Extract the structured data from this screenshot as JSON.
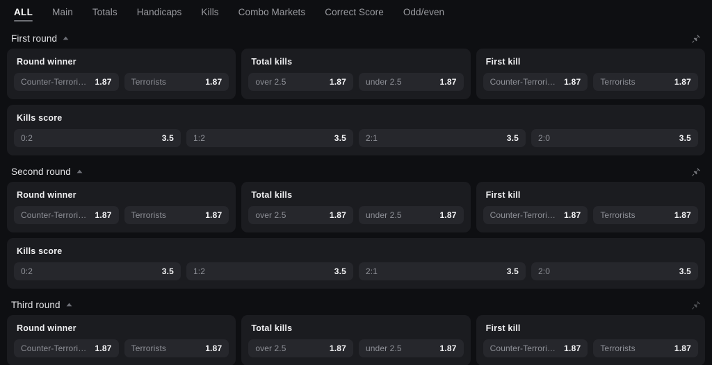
{
  "tabs": [
    {
      "label": "ALL",
      "active": true
    },
    {
      "label": "Main",
      "active": false
    },
    {
      "label": "Totals",
      "active": false
    },
    {
      "label": "Handicaps",
      "active": false
    },
    {
      "label": "Kills",
      "active": false
    },
    {
      "label": "Combo Markets",
      "active": false
    },
    {
      "label": "Correct Score",
      "active": false
    },
    {
      "label": "Odd/even",
      "active": false
    }
  ],
  "colors": {
    "page_background": "#0e0f12",
    "card_background": "#1b1c20",
    "odd_background": "#26272c",
    "label_text": "#8e9097",
    "value_text": "#f4f4f6",
    "active_tab_text": "#ffffff",
    "inactive_tab_text": "#9b9ca1",
    "active_tab_underline": "#6f7176"
  },
  "icons": {
    "collapse": "chevron-up-icon",
    "pin": "pin-icon"
  },
  "sections": [
    {
      "title": "First round",
      "collapsed": false,
      "pinned": false,
      "pin_dim": false,
      "rows": [
        {
          "cards": [
            {
              "title": "Round winner",
              "full": false,
              "odds": [
                {
                  "label": "Counter-Terrorists",
                  "value": "1.87"
                },
                {
                  "label": "Terrorists",
                  "value": "1.87"
                }
              ]
            },
            {
              "title": "Total kills",
              "full": false,
              "odds": [
                {
                  "label": "over 2.5",
                  "value": "1.87"
                },
                {
                  "label": "under 2.5",
                  "value": "1.87"
                }
              ]
            },
            {
              "title": "First kill",
              "full": false,
              "odds": [
                {
                  "label": "Counter-Terrorists",
                  "value": "1.87"
                },
                {
                  "label": "Terrorists",
                  "value": "1.87"
                }
              ]
            }
          ]
        },
        {
          "cards": [
            {
              "title": "Kills score",
              "full": true,
              "odds": [
                {
                  "label": "0:2",
                  "value": "3.5"
                },
                {
                  "label": "1:2",
                  "value": "3.5"
                },
                {
                  "label": "2:1",
                  "value": "3.5"
                },
                {
                  "label": "2:0",
                  "value": "3.5"
                }
              ]
            }
          ]
        }
      ]
    },
    {
      "title": "Second round",
      "collapsed": false,
      "pinned": false,
      "pin_dim": false,
      "rows": [
        {
          "cards": [
            {
              "title": "Round winner",
              "full": false,
              "odds": [
                {
                  "label": "Counter-Terrorists",
                  "value": "1.87"
                },
                {
                  "label": "Terrorists",
                  "value": "1.87"
                }
              ]
            },
            {
              "title": "Total kills",
              "full": false,
              "odds": [
                {
                  "label": "over 2.5",
                  "value": "1.87"
                },
                {
                  "label": "under 2.5",
                  "value": "1.87"
                }
              ]
            },
            {
              "title": "First kill",
              "full": false,
              "odds": [
                {
                  "label": "Counter-Terrorists",
                  "value": "1.87"
                },
                {
                  "label": "Terrorists",
                  "value": "1.87"
                }
              ]
            }
          ]
        },
        {
          "cards": [
            {
              "title": "Kills score",
              "full": true,
              "odds": [
                {
                  "label": "0:2",
                  "value": "3.5"
                },
                {
                  "label": "1:2",
                  "value": "3.5"
                },
                {
                  "label": "2:1",
                  "value": "3.5"
                },
                {
                  "label": "2:0",
                  "value": "3.5"
                }
              ]
            }
          ]
        }
      ]
    },
    {
      "title": "Third round",
      "collapsed": false,
      "pinned": false,
      "pin_dim": true,
      "rows": [
        {
          "cards": [
            {
              "title": "Round winner",
              "full": false,
              "odds": [
                {
                  "label": "Counter-Terrorists",
                  "value": "1.87"
                },
                {
                  "label": "Terrorists",
                  "value": "1.87"
                }
              ]
            },
            {
              "title": "Total kills",
              "full": false,
              "odds": [
                {
                  "label": "over 2.5",
                  "value": "1.87"
                },
                {
                  "label": "under 2.5",
                  "value": "1.87"
                }
              ]
            },
            {
              "title": "First kill",
              "full": false,
              "odds": [
                {
                  "label": "Counter-Terrorists",
                  "value": "1.87"
                },
                {
                  "label": "Terrorists",
                  "value": "1.87"
                }
              ]
            }
          ]
        }
      ]
    }
  ]
}
